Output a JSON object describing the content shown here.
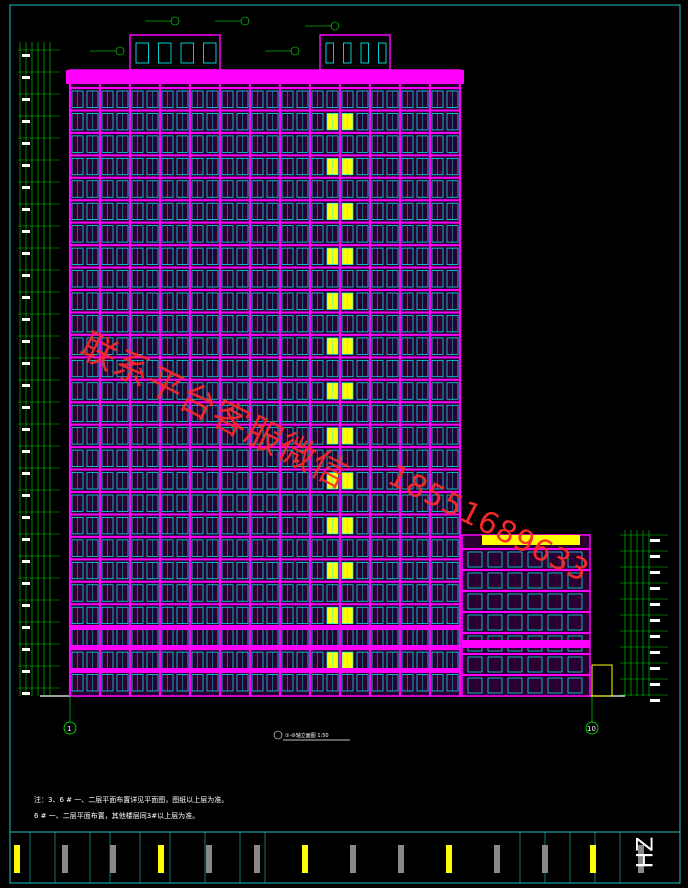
{
  "drawing": {
    "elevation_label": "①-⑩轴立面图",
    "scale": "1:50",
    "axis_left": "1",
    "axis_right": "10"
  },
  "notes": {
    "n1": "注：3、6 # 一、二层平面布置详见平面图，图纸以上层为准。",
    "n2": "6 # 一、二层平面布置，其他楼层同3#以上层为准。"
  },
  "watermark": {
    "line1": "联系平台客服微信",
    "line2": "18551689633"
  },
  "titleblock": {
    "code": "HZ"
  },
  "colors": {
    "background": "#000000",
    "facade": "#ff00ff",
    "window": "#00ffff",
    "accent": "#ffff00",
    "grid": "#00ff00",
    "frame": "#20c0c0"
  }
}
